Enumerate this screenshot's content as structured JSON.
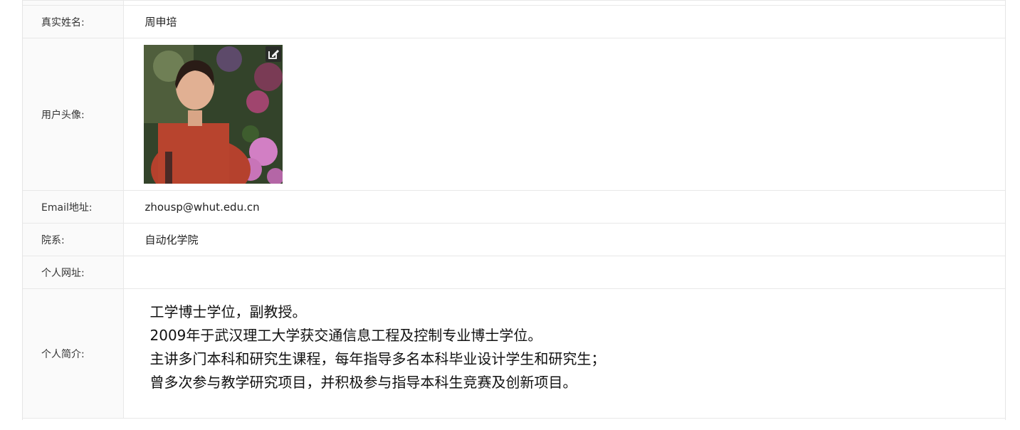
{
  "profile": {
    "real_name_label": "真实姓名:",
    "real_name": "周申培",
    "avatar_label": "用户头像:",
    "avatar_icon": "edit-icon",
    "email_label": "Email地址:",
    "email": "zhousp@whut.edu.cn",
    "department_label": "院系:",
    "department": "自动化学院",
    "homepage_label": "个人网址:",
    "homepage": "",
    "bio_label": "个人简介:",
    "bio_lines": [
      "工学博士学位，副教授。",
      "2009年于武汉理工大学获交通信息工程及控制专业博士学位。",
      "主讲多门本科和研究生课程，每年指导多名本科毕业设计学生和研究生；",
      "曾多次参与教学研究项目，并积极参与指导本科生竞赛及创新项目。"
    ]
  }
}
